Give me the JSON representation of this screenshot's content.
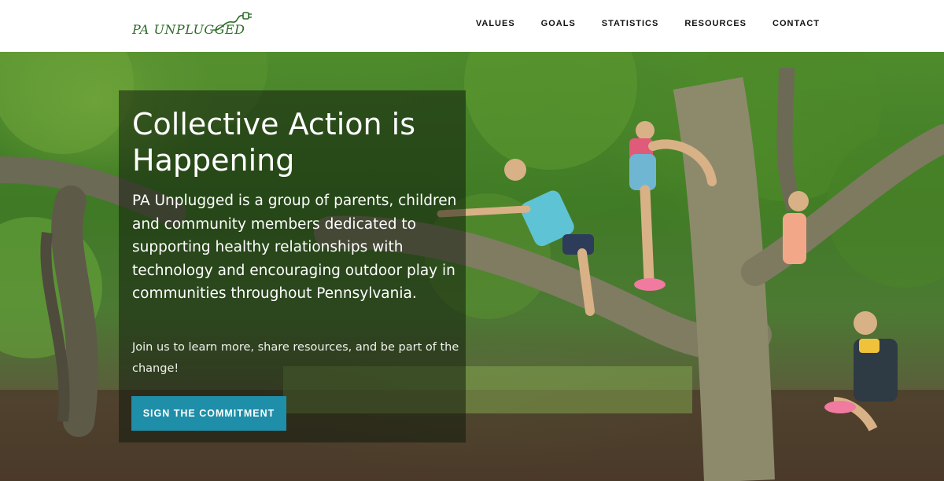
{
  "brand": {
    "logo_text": "PA UNPLUGGED"
  },
  "nav": {
    "items": [
      {
        "label": "VALUES"
      },
      {
        "label": "GOALS"
      },
      {
        "label": "STATISTICS"
      },
      {
        "label": "RESOURCES"
      },
      {
        "label": "CONTACT"
      }
    ]
  },
  "hero": {
    "title": "Collective Action is Happening",
    "lead": "PA Unplugged is a group of parents, children and community members dedicated to supporting healthy relationships with technology and encouraging outdoor play in communities throughout Pennsylvania.",
    "subtext": "Join us to learn more, share resources, and be part of the change!",
    "cta_label": "SIGN THE COMMITMENT"
  },
  "colors": {
    "logo_green": "#2f6b2a",
    "cta_blue": "#1f8ea8",
    "nav_text": "#111111"
  }
}
